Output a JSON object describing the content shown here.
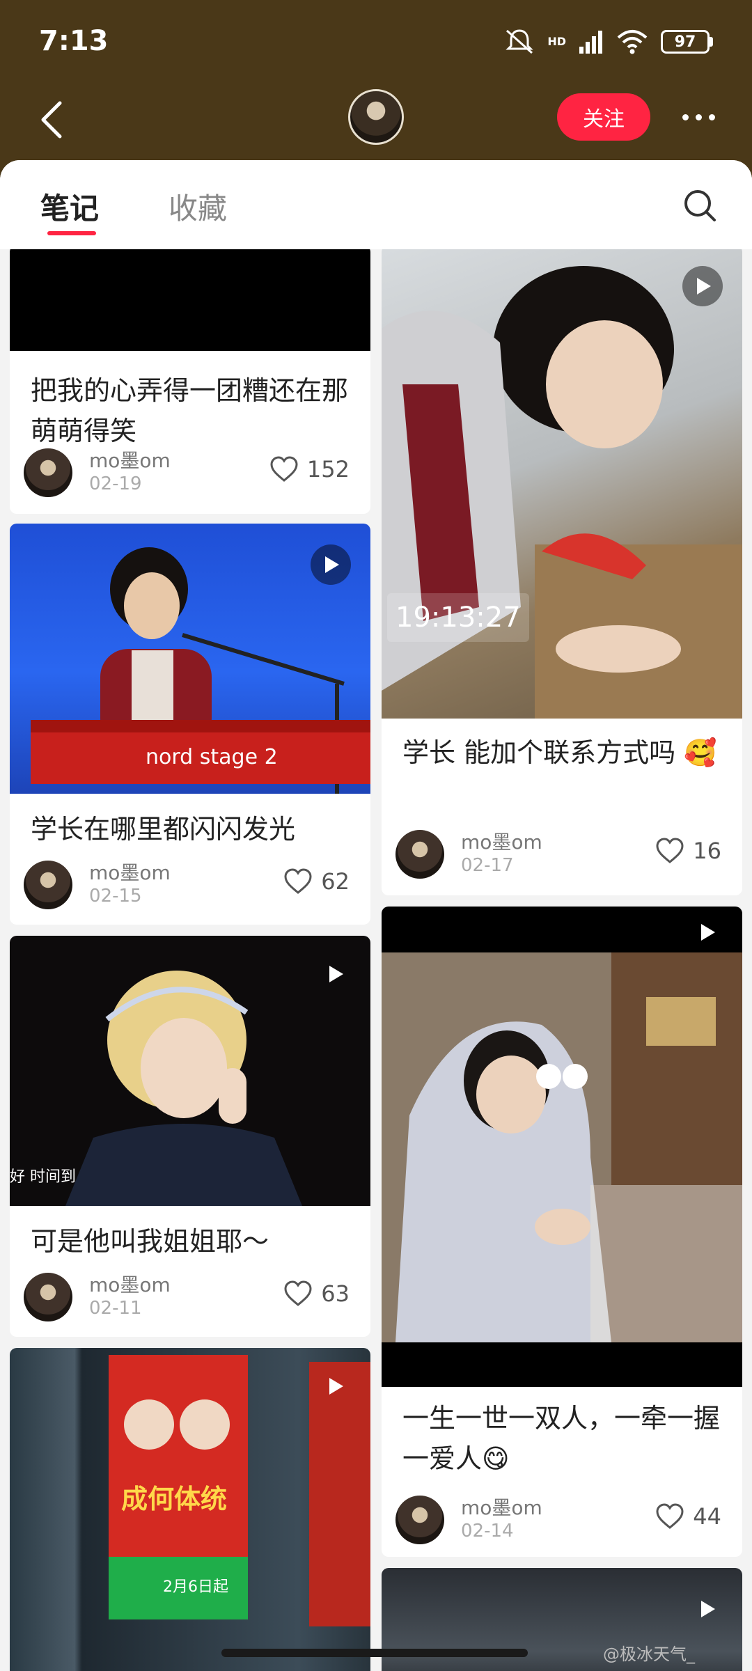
{
  "status_bar": {
    "time": "7:13",
    "battery": "97",
    "network": "HD",
    "icons": [
      "mute-icon",
      "signal-icon",
      "wifi-icon",
      "battery-icon"
    ]
  },
  "header": {
    "follow_label": "关注"
  },
  "tabs": [
    {
      "label": "笔记",
      "active": true
    },
    {
      "label": "收藏",
      "active": false
    }
  ],
  "notes_left": [
    {
      "title": "把我的心弄得一团糟还在那萌萌得笑",
      "author": "mo墨om",
      "date": "02-19",
      "likes": "152",
      "is_video": false
    },
    {
      "title": "学长在哪里都闪闪发光",
      "author": "mo墨om",
      "date": "02-15",
      "likes": "62",
      "is_video": true
    },
    {
      "title": "可是他叫我姐姐耶～",
      "author": "mo墨om",
      "date": "02-11",
      "likes": "63",
      "is_video": true,
      "caption": "好 时间到"
    },
    {
      "title": "",
      "author": "",
      "date": "",
      "likes": "",
      "is_video": true,
      "poster_text": "成何体统",
      "poster_sub": "2月6日起"
    }
  ],
  "notes_right": [
    {
      "title": "学长 能加个联系方式吗 🥰",
      "author": "mo墨om",
      "date": "02-17",
      "likes": "16",
      "is_video": true,
      "overlay_time": "19:13:27"
    },
    {
      "title": "一生一世一双人，一牵一握一爱人😋",
      "author": "mo墨om",
      "date": "02-14",
      "likes": "44",
      "is_video": true
    },
    {
      "title": "",
      "author": "",
      "date": "",
      "likes": "",
      "is_video": true
    }
  ],
  "watermark": "@极冰天气_",
  "colors": {
    "accent": "#ff2442",
    "header_bg": "#4a3818"
  }
}
